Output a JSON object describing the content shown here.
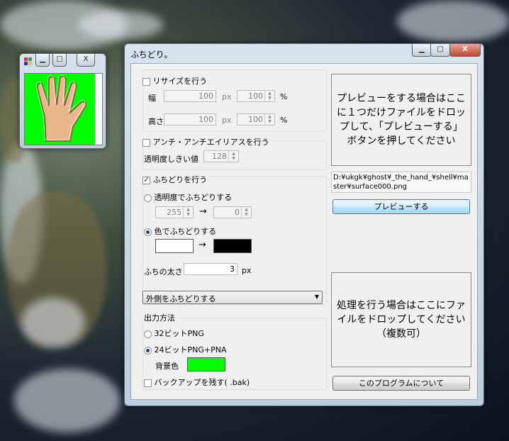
{
  "small_window": {
    "title_icon": "app-icon"
  },
  "main_window": {
    "title": "ふちどり。",
    "buttons": {
      "minimize": "▁",
      "maximize": "□",
      "close": "X"
    }
  },
  "resize": {
    "checkbox_label": "リサイズを行う",
    "checked": false,
    "width_label": "幅",
    "width_px": "100",
    "width_pct": "100",
    "height_label": "高さ",
    "height_px": "100",
    "height_pct": "100",
    "px_unit": "px",
    "pct_unit": "%"
  },
  "antialias": {
    "checkbox_label": "アンチ・アンチエイリアスを行う",
    "checked": false,
    "threshold_label": "透明度しきい値",
    "threshold_value": "128"
  },
  "border": {
    "checkbox_label": "ふちどりを行う",
    "checked": true,
    "alpha_radio_label": "透明度でふちどりする",
    "alpha_from": "255",
    "alpha_to": "0",
    "arrow": "→",
    "color_radio_label": "色でふちどりする",
    "color_from": "#ffffff",
    "color_to": "#000000",
    "thickness_label": "ふちの太さ",
    "thickness_value": "3",
    "thickness_unit": "px",
    "mode_selected": "外側をふちどりする"
  },
  "output": {
    "group_label": "出力方法",
    "option_32": "32ビットPNG",
    "option_24": "24ビットPNG+PNA",
    "selected": "24ビットPNG+PNA",
    "bg_label": "背景色",
    "bg_color": "#00ff00",
    "backup_label": "バックアップを残す( .bak)",
    "backup_checked": false
  },
  "preview": {
    "drop_text": "プレビューをする場合はここに１つだけファイルをドロップして、「プレビューする」ボタンを押してください",
    "file_path": "D:¥ukgk¥ghost¥_the_hand_¥shell¥master¥surface000.png",
    "button_label": "プレビューする"
  },
  "process": {
    "drop_text": "処理を行う場合はここにファイルをドロップしてください（複数可）"
  },
  "about_button": "このプログラムについて"
}
